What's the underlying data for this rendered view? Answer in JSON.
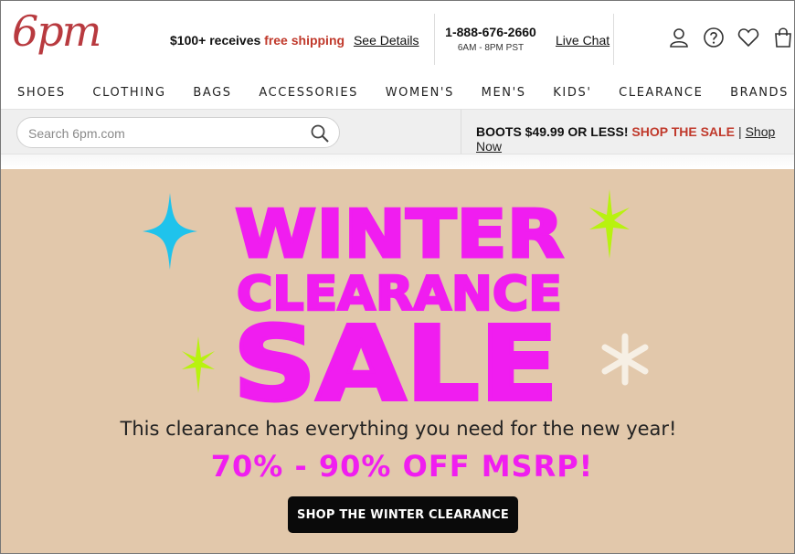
{
  "header": {
    "logo_text": "6pm",
    "promo_lead": "$100+ receives ",
    "promo_accent": "free shipping",
    "promo_link": "See Details",
    "phone": "1-888-676-2660",
    "hours": "6AM - 8PM PST",
    "live_chat": "Live Chat",
    "icons": [
      "user-icon",
      "help-icon",
      "heart-icon",
      "bag-icon"
    ]
  },
  "nav": {
    "items": [
      "SHOES",
      "CLOTHING",
      "BAGS",
      "ACCESSORIES",
      "WOMEN'S",
      "MEN'S",
      "KIDS'",
      "CLEARANCE",
      "BRANDS"
    ]
  },
  "search": {
    "placeholder": "Search 6pm.com"
  },
  "promo_bar": {
    "lead": "BOOTS $49.99 OR LESS! ",
    "accent": "SHOP THE SALE",
    "divider": "|",
    "link": "Shop Now"
  },
  "hero": {
    "title_line1": "WINTER",
    "title_line2": "CLEARANCE",
    "title_line3": "SALE",
    "subline": "This clearance has everything you need for the new year!",
    "discount": "70% - 90% OFF MSRP!",
    "cta": "SHOP THE WINTER CLEARANCE"
  },
  "colors": {
    "brand": "#b83a3f",
    "hero_bg": "#e2c8ab",
    "hero_magenta": "#f01df0",
    "star_cyan": "#1fc3ec",
    "star_lime": "#b8f20f",
    "star_cream": "#f6efe4"
  }
}
